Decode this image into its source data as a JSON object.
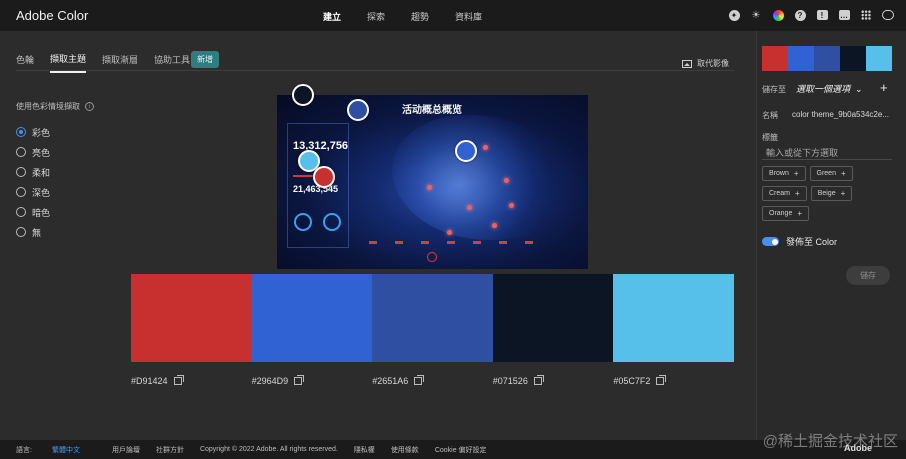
{
  "header": {
    "brand": "Adobe Color",
    "nav": [
      {
        "label": "建立",
        "active": true
      },
      {
        "label": "探索",
        "active": false
      },
      {
        "label": "趨勢",
        "active": false
      },
      {
        "label": "資料庫",
        "active": false
      }
    ],
    "icons": [
      "awards-icon",
      "theme-icon",
      "color-wheel-icon",
      "help-icon",
      "alert-icon",
      "chat-icon",
      "apps-grid-icon",
      "creative-cloud-icon"
    ]
  },
  "tabs": [
    {
      "label": "色輪",
      "active": false
    },
    {
      "label": "擷取主題",
      "active": true
    },
    {
      "label": "擷取漸層",
      "active": false
    },
    {
      "label": "協助工具",
      "active": false
    }
  ],
  "new_badge": "新增",
  "replace_image": "取代影像",
  "mood": {
    "label": "使用色彩情境擷取",
    "options": [
      {
        "label": "彩色",
        "selected": true
      },
      {
        "label": "亮色",
        "selected": false
      },
      {
        "label": "柔和",
        "selected": false
      },
      {
        "label": "深色",
        "selected": false
      },
      {
        "label": "暗色",
        "selected": false
      },
      {
        "label": "無",
        "selected": false
      }
    ]
  },
  "image": {
    "title": "活动概总概览",
    "big_number": "13,312,756",
    "second_number": "21,463,545"
  },
  "palette": [
    {
      "hex": "#D91424",
      "color": "#c8302f"
    },
    {
      "hex": "#2964D9",
      "color": "#3062d4"
    },
    {
      "hex": "#2651A6",
      "color": "#2f4fa3"
    },
    {
      "hex": "#071526",
      "color": "#0b1524"
    },
    {
      "hex": "#05C7F2",
      "color": "#57c0ea"
    }
  ],
  "right_panel": {
    "save_to_label": "儲存至",
    "save_to_value": "選取一個選項",
    "name_label": "名稱",
    "name_value": "color theme_9b0a534c2e...",
    "tags_label": "標籤",
    "tags_placeholder": "輸入或從下方選取",
    "tags": [
      "Brown",
      "Green",
      "Cream",
      "Beige",
      "Orange"
    ],
    "publish_label": "發佈至 Color",
    "save_button": "儲存"
  },
  "footer": {
    "language_label": "語言:",
    "language_value": "繁體中文",
    "links": [
      "用戶論壇",
      "社群方針",
      "Copyright © 2022 Adobe. All rights reserved.",
      "隱私權",
      "使用條款",
      "Cookie 偏好設定"
    ],
    "logo": "Adobe"
  },
  "watermark": "@稀土掘金技术社区"
}
